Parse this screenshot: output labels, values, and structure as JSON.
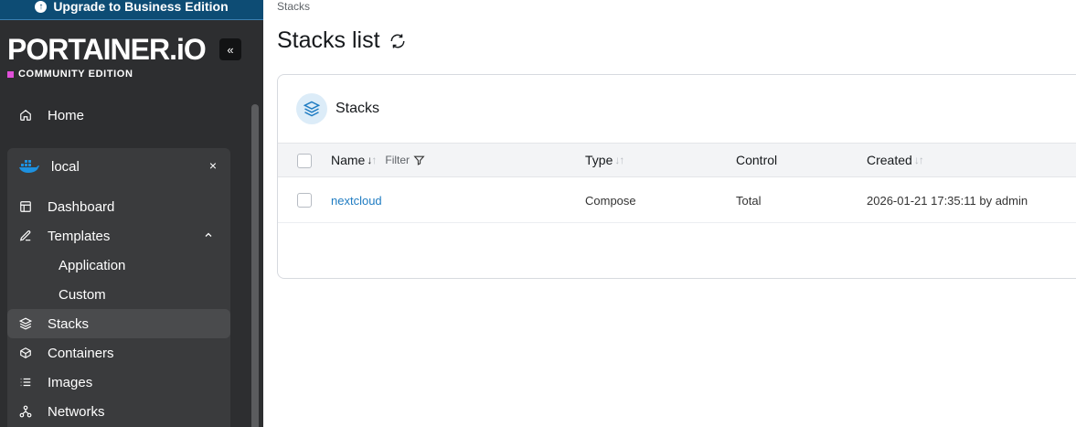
{
  "sidebar": {
    "upgrade_label": "Upgrade to Business Edition",
    "logo": "PORTAINER.iO",
    "edition": "COMMUNITY EDITION",
    "collapse_label": "«",
    "home_label": "Home",
    "environment": {
      "name": "local",
      "close_label": "×",
      "items": [
        {
          "label": "Dashboard"
        },
        {
          "label": "Templates"
        },
        {
          "label": "Application"
        },
        {
          "label": "Custom"
        },
        {
          "label": "Stacks"
        },
        {
          "label": "Containers"
        },
        {
          "label": "Images"
        },
        {
          "label": "Networks"
        }
      ]
    },
    "colors": {
      "background": "#2d2e30",
      "upgrade_bar": "#0d4c74",
      "edition_accent": "#e04fd9"
    }
  },
  "breadcrumb": "Stacks",
  "page_title": "Stacks list",
  "card": {
    "title": "Stacks",
    "columns": {
      "name": "Name",
      "filter": "Filter",
      "type": "Type",
      "control": "Control",
      "created": "Created"
    },
    "rows": [
      {
        "name": "nextcloud",
        "type": "Compose",
        "control": "Total",
        "created": "2026-01-21 17:35:11 by admin"
      }
    ]
  },
  "icons": [
    "arrow-up-circle-icon",
    "chevrons-left-icon",
    "home-icon",
    "docker-icon",
    "close-icon",
    "dashboard-icon",
    "edit-icon",
    "chevron-up-icon",
    "layers-icon",
    "box-icon",
    "list-icon",
    "network-icon",
    "refresh-icon",
    "filter-icon",
    "sort-icon"
  ]
}
